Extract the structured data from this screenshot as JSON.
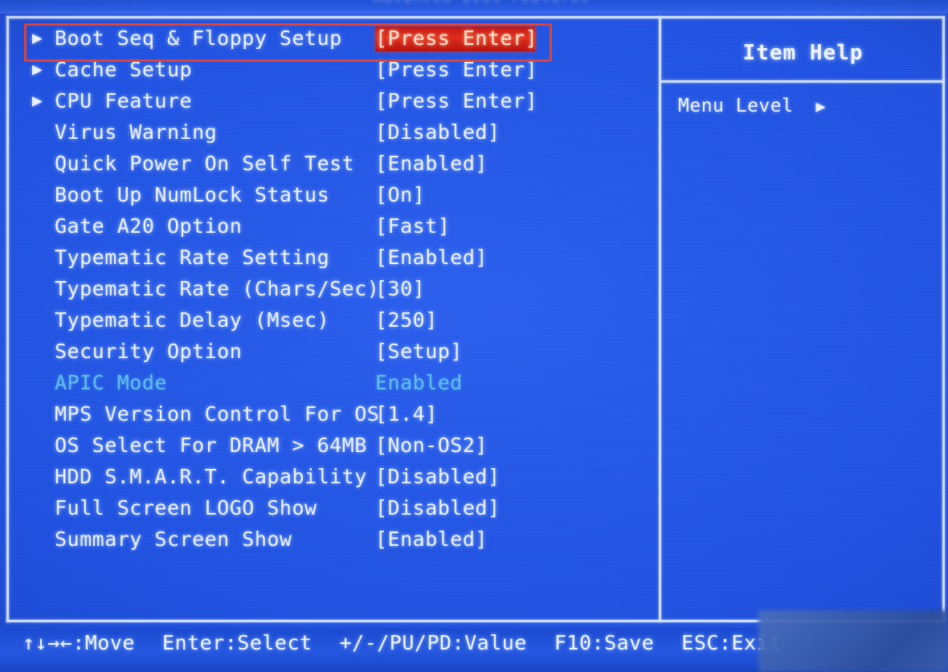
{
  "title_ghost": "Advanced BIOS Features",
  "colors": {
    "background": "#1f51e2",
    "text": "#eef4ff",
    "frame": "#cfe0ff",
    "dim_text": "#5fc0ef",
    "highlight_bg": "#e02a1a",
    "highlight_text": "#ffe6d2",
    "annotation": "#e04236"
  },
  "menu": {
    "items": [
      {
        "arrow": "▶",
        "label": "Boot Seq & Floppy Setup",
        "value": "[Press Enter]",
        "submenu": true,
        "selected": true,
        "dim": false
      },
      {
        "arrow": "▶",
        "label": "Cache Setup",
        "value": "[Press Enter]",
        "submenu": true,
        "selected": false,
        "dim": false
      },
      {
        "arrow": "▶",
        "label": "CPU Feature",
        "value": "[Press Enter]",
        "submenu": true,
        "selected": false,
        "dim": false
      },
      {
        "arrow": "",
        "label": "Virus Warning",
        "value": "[Disabled]",
        "submenu": false,
        "selected": false,
        "dim": false
      },
      {
        "arrow": "",
        "label": "Quick Power On Self Test",
        "value": "[Enabled]",
        "submenu": false,
        "selected": false,
        "dim": false
      },
      {
        "arrow": "",
        "label": "Boot Up NumLock Status",
        "value": "[On]",
        "submenu": false,
        "selected": false,
        "dim": false
      },
      {
        "arrow": "",
        "label": "Gate A20 Option",
        "value": "[Fast]",
        "submenu": false,
        "selected": false,
        "dim": false
      },
      {
        "arrow": "",
        "label": "Typematic Rate Setting",
        "value": "[Enabled]",
        "submenu": false,
        "selected": false,
        "dim": false
      },
      {
        "arrow": "",
        "label": "Typematic Rate (Chars/Sec)",
        "value": "[30]",
        "submenu": false,
        "selected": false,
        "dim": false
      },
      {
        "arrow": "",
        "label": "Typematic Delay (Msec)",
        "value": "[250]",
        "submenu": false,
        "selected": false,
        "dim": false
      },
      {
        "arrow": "",
        "label": "Security Option",
        "value": "[Setup]",
        "submenu": false,
        "selected": false,
        "dim": false
      },
      {
        "arrow": "",
        "label": "APIC Mode",
        "value": "Enabled",
        "submenu": false,
        "selected": false,
        "dim": true
      },
      {
        "arrow": "",
        "label": "MPS Version Control For OS",
        "value": "[1.4]",
        "submenu": false,
        "selected": false,
        "dim": false
      },
      {
        "arrow": "",
        "label": "OS Select For DRAM > 64MB",
        "value": "[Non-OS2]",
        "submenu": false,
        "selected": false,
        "dim": false
      },
      {
        "arrow": "",
        "label": "HDD S.M.A.R.T. Capability",
        "value": "[Disabled]",
        "submenu": false,
        "selected": false,
        "dim": false
      },
      {
        "arrow": "",
        "label": "Full Screen LOGO Show",
        "value": "[Disabled]",
        "submenu": false,
        "selected": false,
        "dim": false
      },
      {
        "arrow": "",
        "label": "Summary Screen Show",
        "value": "[Enabled]",
        "submenu": false,
        "selected": false,
        "dim": false
      }
    ]
  },
  "help": {
    "title": "Item Help",
    "menu_level_label": "Menu Level",
    "menu_level_arrow": "▶"
  },
  "status": {
    "keys": [
      "↑↓→←:Move",
      "Enter:Select",
      "+/-/PU/PD:Value",
      "F10:Save",
      "ESC:Exit"
    ]
  }
}
